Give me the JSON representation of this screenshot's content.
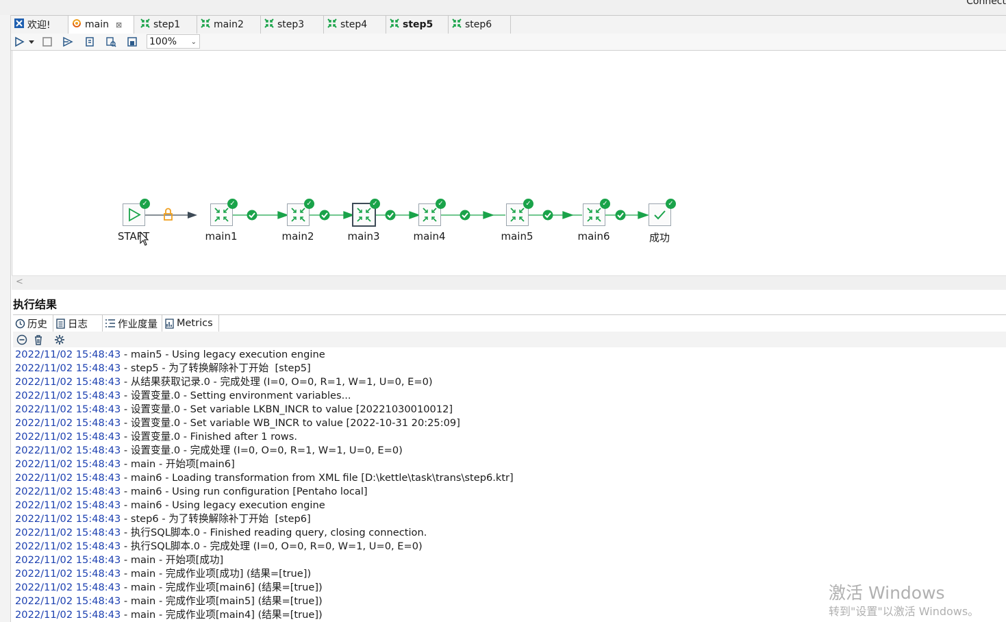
{
  "window": {
    "connect_label": "Connect"
  },
  "tabs": [
    {
      "label": "欢迎!",
      "icon": "welcome-icon"
    },
    {
      "label": "main",
      "icon": "job-icon",
      "active": true
    },
    {
      "label": "step1",
      "icon": "transformation-icon"
    },
    {
      "label": "main2",
      "icon": "transformation-icon"
    },
    {
      "label": "step3",
      "icon": "transformation-icon"
    },
    {
      "label": "step4",
      "icon": "transformation-icon"
    },
    {
      "label": "step5",
      "icon": "transformation-icon",
      "bold": true
    },
    {
      "label": "step6",
      "icon": "transformation-icon"
    }
  ],
  "toolbar": {
    "zoom": "100%"
  },
  "canvas": {
    "nodes": [
      {
        "label": "START",
        "icon": "start-icon",
        "status": "success"
      },
      {
        "label": "main1",
        "icon": "transformation-icon",
        "status": "success"
      },
      {
        "label": "main2",
        "icon": "transformation-icon",
        "status": "success"
      },
      {
        "label": "main3",
        "icon": "transformation-icon",
        "status": "success",
        "selected": true
      },
      {
        "label": "main4",
        "icon": "transformation-icon",
        "status": "success"
      },
      {
        "label": "main5",
        "icon": "transformation-icon",
        "status": "success"
      },
      {
        "label": "main6",
        "icon": "transformation-icon",
        "status": "success"
      },
      {
        "label": "成功",
        "icon": "success-icon",
        "status": "success"
      }
    ]
  },
  "results": {
    "title": "执行结果",
    "tabs": [
      {
        "label": "历史",
        "icon": "history-icon"
      },
      {
        "label": "日志",
        "icon": "log-icon",
        "active": true
      },
      {
        "label": "作业度量",
        "icon": "job-metrics-icon"
      },
      {
        "label": "Metrics",
        "icon": "metrics-icon"
      }
    ],
    "log": [
      {
        "ts": "2022/11/02 15:48:43",
        "msg": " - main5 - Using legacy execution engine"
      },
      {
        "ts": "2022/11/02 15:48:43",
        "msg": " - step5 - 为了转换解除补丁开始  [step5]"
      },
      {
        "ts": "2022/11/02 15:48:43",
        "msg": " - 从结果获取记录.0 - 完成处理 (I=0, O=0, R=1, W=1, U=0, E=0)"
      },
      {
        "ts": "2022/11/02 15:48:43",
        "msg": " - 设置变量.0 - Setting environment variables..."
      },
      {
        "ts": "2022/11/02 15:48:43",
        "msg": " - 设置变量.0 - Set variable LKBN_INCR to value [20221030010012]"
      },
      {
        "ts": "2022/11/02 15:48:43",
        "msg": " - 设置变量.0 - Set variable WB_INCR to value [2022-10-31 20:25:09]"
      },
      {
        "ts": "2022/11/02 15:48:43",
        "msg": " - 设置变量.0 - Finished after 1 rows."
      },
      {
        "ts": "2022/11/02 15:48:43",
        "msg": " - 设置变量.0 - 完成处理 (I=0, O=0, R=1, W=1, U=0, E=0)"
      },
      {
        "ts": "2022/11/02 15:48:43",
        "msg": " - main - 开始项[main6]"
      },
      {
        "ts": "2022/11/02 15:48:43",
        "msg": " - main6 - Loading transformation from XML file [D:\\kettle\\task\\trans\\step6.ktr]"
      },
      {
        "ts": "2022/11/02 15:48:43",
        "msg": " - main6 - Using run configuration [Pentaho local]"
      },
      {
        "ts": "2022/11/02 15:48:43",
        "msg": " - main6 - Using legacy execution engine"
      },
      {
        "ts": "2022/11/02 15:48:43",
        "msg": " - step6 - 为了转换解除补丁开始  [step6]"
      },
      {
        "ts": "2022/11/02 15:48:43",
        "msg": " - 执行SQL脚本.0 - Finished reading query, closing connection."
      },
      {
        "ts": "2022/11/02 15:48:43",
        "msg": " - 执行SQL脚本.0 - 完成处理 (I=0, O=0, R=0, W=1, U=0, E=0)"
      },
      {
        "ts": "2022/11/02 15:48:43",
        "msg": " - main - 开始项[成功]"
      },
      {
        "ts": "2022/11/02 15:48:43",
        "msg": " - main - 完成作业项[成功] (结果=[true])"
      },
      {
        "ts": "2022/11/02 15:48:43",
        "msg": " - main - 完成作业项[main6] (结果=[true])"
      },
      {
        "ts": "2022/11/02 15:48:43",
        "msg": " - main - 完成作业项[main5] (结果=[true])"
      },
      {
        "ts": "2022/11/02 15:48:43",
        "msg": " - main - 完成作业项[main4] (结果=[true])"
      }
    ]
  },
  "watermark": {
    "line1": "激活 Windows",
    "line2": "转到\"设置\"以激活 Windows。"
  },
  "colors": {
    "success": "#1aa34a",
    "timestamp": "#1b3fb0",
    "hop": "#1aa34a",
    "hop_unconditional": "#3d4a56",
    "lock": "#f0a020"
  }
}
